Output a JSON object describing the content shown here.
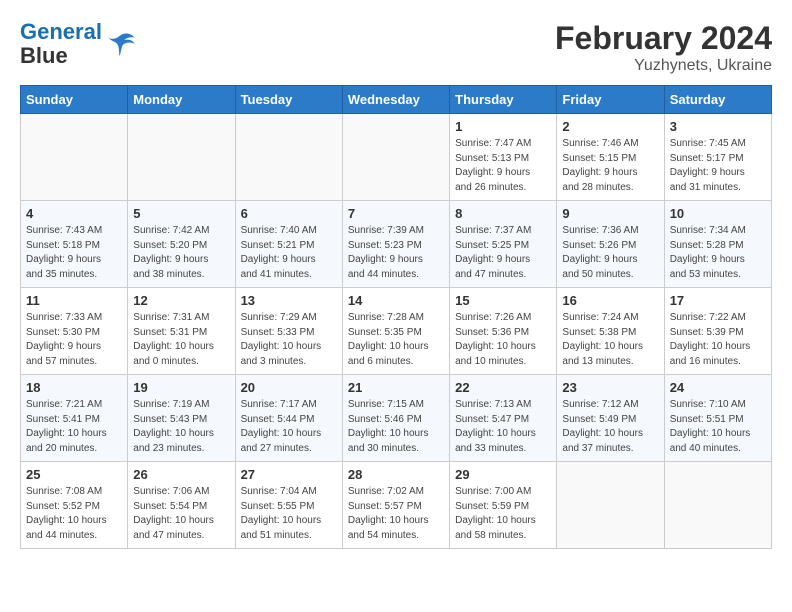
{
  "header": {
    "logo_line1": "General",
    "logo_line2": "Blue",
    "main_title": "February 2024",
    "subtitle": "Yuzhynets, Ukraine"
  },
  "weekdays": [
    "Sunday",
    "Monday",
    "Tuesday",
    "Wednesday",
    "Thursday",
    "Friday",
    "Saturday"
  ],
  "weeks": [
    [
      {
        "day": "",
        "info": ""
      },
      {
        "day": "",
        "info": ""
      },
      {
        "day": "",
        "info": ""
      },
      {
        "day": "",
        "info": ""
      },
      {
        "day": "1",
        "info": "Sunrise: 7:47 AM\nSunset: 5:13 PM\nDaylight: 9 hours\nand 26 minutes."
      },
      {
        "day": "2",
        "info": "Sunrise: 7:46 AM\nSunset: 5:15 PM\nDaylight: 9 hours\nand 28 minutes."
      },
      {
        "day": "3",
        "info": "Sunrise: 7:45 AM\nSunset: 5:17 PM\nDaylight: 9 hours\nand 31 minutes."
      }
    ],
    [
      {
        "day": "4",
        "info": "Sunrise: 7:43 AM\nSunset: 5:18 PM\nDaylight: 9 hours\nand 35 minutes."
      },
      {
        "day": "5",
        "info": "Sunrise: 7:42 AM\nSunset: 5:20 PM\nDaylight: 9 hours\nand 38 minutes."
      },
      {
        "day": "6",
        "info": "Sunrise: 7:40 AM\nSunset: 5:21 PM\nDaylight: 9 hours\nand 41 minutes."
      },
      {
        "day": "7",
        "info": "Sunrise: 7:39 AM\nSunset: 5:23 PM\nDaylight: 9 hours\nand 44 minutes."
      },
      {
        "day": "8",
        "info": "Sunrise: 7:37 AM\nSunset: 5:25 PM\nDaylight: 9 hours\nand 47 minutes."
      },
      {
        "day": "9",
        "info": "Sunrise: 7:36 AM\nSunset: 5:26 PM\nDaylight: 9 hours\nand 50 minutes."
      },
      {
        "day": "10",
        "info": "Sunrise: 7:34 AM\nSunset: 5:28 PM\nDaylight: 9 hours\nand 53 minutes."
      }
    ],
    [
      {
        "day": "11",
        "info": "Sunrise: 7:33 AM\nSunset: 5:30 PM\nDaylight: 9 hours\nand 57 minutes."
      },
      {
        "day": "12",
        "info": "Sunrise: 7:31 AM\nSunset: 5:31 PM\nDaylight: 10 hours\nand 0 minutes."
      },
      {
        "day": "13",
        "info": "Sunrise: 7:29 AM\nSunset: 5:33 PM\nDaylight: 10 hours\nand 3 minutes."
      },
      {
        "day": "14",
        "info": "Sunrise: 7:28 AM\nSunset: 5:35 PM\nDaylight: 10 hours\nand 6 minutes."
      },
      {
        "day": "15",
        "info": "Sunrise: 7:26 AM\nSunset: 5:36 PM\nDaylight: 10 hours\nand 10 minutes."
      },
      {
        "day": "16",
        "info": "Sunrise: 7:24 AM\nSunset: 5:38 PM\nDaylight: 10 hours\nand 13 minutes."
      },
      {
        "day": "17",
        "info": "Sunrise: 7:22 AM\nSunset: 5:39 PM\nDaylight: 10 hours\nand 16 minutes."
      }
    ],
    [
      {
        "day": "18",
        "info": "Sunrise: 7:21 AM\nSunset: 5:41 PM\nDaylight: 10 hours\nand 20 minutes."
      },
      {
        "day": "19",
        "info": "Sunrise: 7:19 AM\nSunset: 5:43 PM\nDaylight: 10 hours\nand 23 minutes."
      },
      {
        "day": "20",
        "info": "Sunrise: 7:17 AM\nSunset: 5:44 PM\nDaylight: 10 hours\nand 27 minutes."
      },
      {
        "day": "21",
        "info": "Sunrise: 7:15 AM\nSunset: 5:46 PM\nDaylight: 10 hours\nand 30 minutes."
      },
      {
        "day": "22",
        "info": "Sunrise: 7:13 AM\nSunset: 5:47 PM\nDaylight: 10 hours\nand 33 minutes."
      },
      {
        "day": "23",
        "info": "Sunrise: 7:12 AM\nSunset: 5:49 PM\nDaylight: 10 hours\nand 37 minutes."
      },
      {
        "day": "24",
        "info": "Sunrise: 7:10 AM\nSunset: 5:51 PM\nDaylight: 10 hours\nand 40 minutes."
      }
    ],
    [
      {
        "day": "25",
        "info": "Sunrise: 7:08 AM\nSunset: 5:52 PM\nDaylight: 10 hours\nand 44 minutes."
      },
      {
        "day": "26",
        "info": "Sunrise: 7:06 AM\nSunset: 5:54 PM\nDaylight: 10 hours\nand 47 minutes."
      },
      {
        "day": "27",
        "info": "Sunrise: 7:04 AM\nSunset: 5:55 PM\nDaylight: 10 hours\nand 51 minutes."
      },
      {
        "day": "28",
        "info": "Sunrise: 7:02 AM\nSunset: 5:57 PM\nDaylight: 10 hours\nand 54 minutes."
      },
      {
        "day": "29",
        "info": "Sunrise: 7:00 AM\nSunset: 5:59 PM\nDaylight: 10 hours\nand 58 minutes."
      },
      {
        "day": "",
        "info": ""
      },
      {
        "day": "",
        "info": ""
      }
    ]
  ]
}
